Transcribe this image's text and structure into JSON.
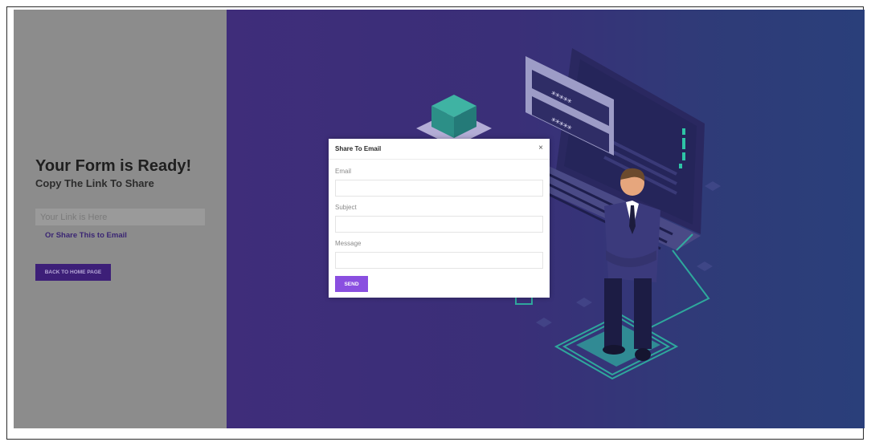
{
  "left": {
    "title": "Your Form is Ready!",
    "subtitle": "Copy The Link To Share",
    "link_placeholder": "Your Link is Here",
    "share_link": "Or Share This to Email",
    "home_button": "BACK TO HOME PAGE"
  },
  "modal": {
    "title": "Share To Email",
    "close": "×",
    "email_label": "Email",
    "subject_label": "Subject",
    "message_label": "Message",
    "send_button": "SEND"
  },
  "illustration": {
    "password_mask_1": "*****",
    "password_mask_2": "*****"
  },
  "colors": {
    "overlay_gray": "#8c8c8c",
    "background_purple": "#3f2d7a",
    "accent_button": "#8a4fe0",
    "dark_button": "#3d1f78",
    "teal": "#2ec4a6"
  }
}
